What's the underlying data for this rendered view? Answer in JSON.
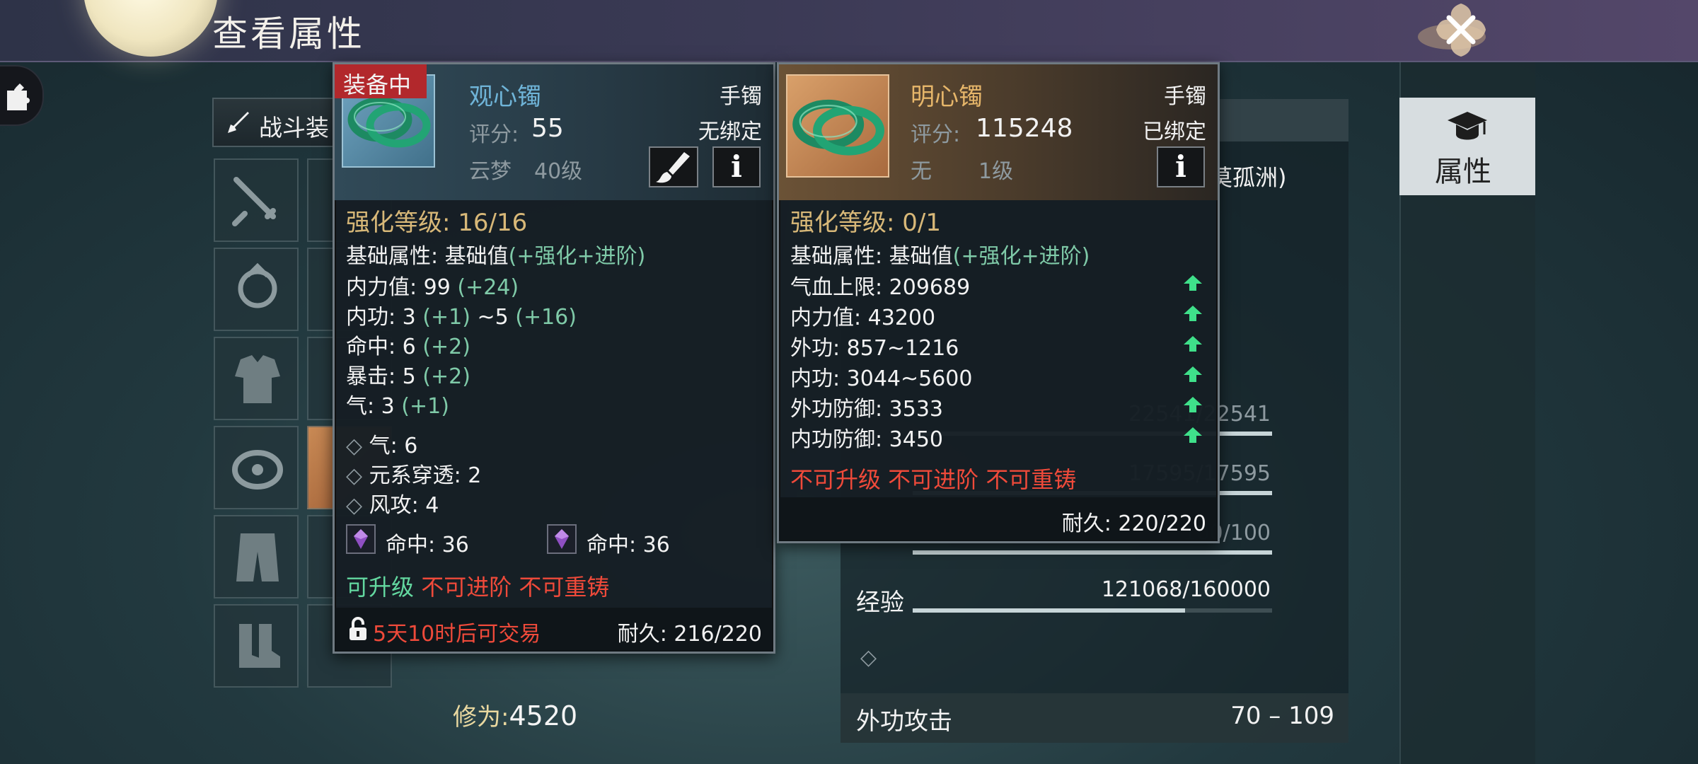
{
  "header": {
    "title": "查看属性"
  },
  "left_panel": {
    "combat_tab_label": "战斗装",
    "cultivation_label": "修为",
    "cultivation_separator": ":",
    "cultivation_value": "4520"
  },
  "attr_panel": {
    "tab_label": "属性",
    "partial_location": "莫孤洲)",
    "bars": [
      {
        "value": "22541/22541",
        "fill": 1.0
      },
      {
        "value": "17595/17595",
        "fill": 1.0
      },
      {
        "value": "100/100",
        "fill": 1.0
      }
    ],
    "experience_label": "经验",
    "experience_value": "121068/160000",
    "experience_fill": 0.757,
    "attack_label": "外功攻击",
    "attack_value": "70 – 109"
  },
  "equipped_item": {
    "status_badge": "装备中",
    "name": "观心镯",
    "type": "手镯",
    "score_label": "评分:",
    "score": "55",
    "bind_status": "无绑定",
    "school": "云梦",
    "level": "40级",
    "enhance": "强化等级: 16/16",
    "base_header": "基础属性: 基础值",
    "base_header_suffix": "(+强化+进阶)",
    "base_stats": [
      {
        "label": "内力值: 99",
        "bonus": "(+24)"
      },
      {
        "label": "内功: 3",
        "bonus": "(+1)",
        "label2": "~5",
        "bonus2": "(+16)"
      },
      {
        "label": "命中: 6",
        "bonus": "(+2)"
      },
      {
        "label": "暴击: 5",
        "bonus": "(+2)"
      },
      {
        "label": "气: 3",
        "bonus": "(+1)"
      }
    ],
    "extra_stats": [
      "气: 6",
      "元系穿透: 2",
      "风攻: 4"
    ],
    "gems": [
      "命中: 36",
      "命中: 36"
    ],
    "upgrade_ok": "可升级",
    "no_advance": "不可进阶",
    "no_recast": "不可重铸",
    "trade_lock": "5天10时后可交易",
    "durability": "耐久: 216/220"
  },
  "compare_item": {
    "name": "明心镯",
    "type": "手镯",
    "score_label": "评分:",
    "score": "115248",
    "bind_status": "已绑定",
    "school": "无",
    "level": "1级",
    "enhance": "强化等级: 0/1",
    "base_header": "基础属性: 基础值",
    "base_header_suffix": "(+强化+进阶)",
    "base_stats": [
      "气血上限: 209689",
      "内力值: 43200",
      "外功: 857~1216",
      "内功: 3044~5600",
      "外功防御: 3533",
      "内功防御: 3450"
    ],
    "restrictions": "不可升级 不可进阶 不可重铸",
    "durability": "耐久: 220/220"
  },
  "colors": {
    "bonus_green": "#7fcaa8",
    "warning_red": "#ef4a3a",
    "enhance_gold": "#d8b878",
    "equipped_name": "#6fb4d8",
    "compare_name": "#e6b66a",
    "badge_red": "#b2282c"
  },
  "icons": [
    "close-icon",
    "puzzle-icon",
    "sword-icon",
    "brush-icon",
    "info-icon",
    "lock-icon",
    "scholar-hat-icon",
    "up-arrow-icon",
    "gem-icon",
    "bracelet-icon"
  ]
}
